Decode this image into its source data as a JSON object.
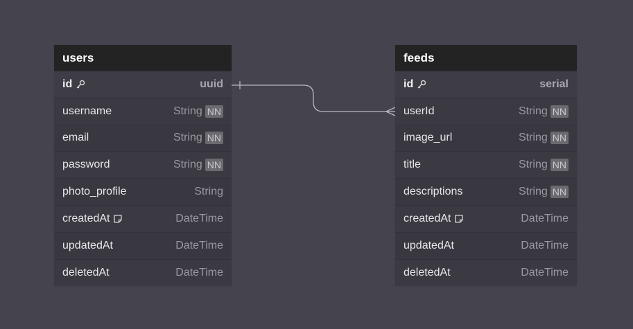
{
  "tables": [
    {
      "name": "users",
      "fields": [
        {
          "name": "id",
          "type": "uuid",
          "pk": true,
          "nn": false,
          "icon": "key-icon"
        },
        {
          "name": "username",
          "type": "String",
          "pk": false,
          "nn": true,
          "icon": ""
        },
        {
          "name": "email",
          "type": "String",
          "pk": false,
          "nn": true,
          "icon": ""
        },
        {
          "name": "password",
          "type": "String",
          "pk": false,
          "nn": true,
          "icon": ""
        },
        {
          "name": "photo_profile",
          "type": "String",
          "pk": false,
          "nn": false,
          "icon": ""
        },
        {
          "name": "createdAt",
          "type": "DateTime",
          "pk": false,
          "nn": false,
          "icon": "note-icon"
        },
        {
          "name": "updatedAt",
          "type": "DateTime",
          "pk": false,
          "nn": false,
          "icon": ""
        },
        {
          "name": "deletedAt",
          "type": "DateTime",
          "pk": false,
          "nn": false,
          "icon": ""
        }
      ]
    },
    {
      "name": "feeds",
      "fields": [
        {
          "name": "id",
          "type": "serial",
          "pk": true,
          "nn": false,
          "icon": "key-icon"
        },
        {
          "name": "userId",
          "type": "String",
          "pk": false,
          "nn": true,
          "icon": ""
        },
        {
          "name": "image_url",
          "type": "String",
          "pk": false,
          "nn": true,
          "icon": ""
        },
        {
          "name": "title",
          "type": "String",
          "pk": false,
          "nn": true,
          "icon": ""
        },
        {
          "name": "descriptions",
          "type": "String",
          "pk": false,
          "nn": true,
          "icon": ""
        },
        {
          "name": "createdAt",
          "type": "DateTime",
          "pk": false,
          "nn": false,
          "icon": "note-icon"
        },
        {
          "name": "updatedAt",
          "type": "DateTime",
          "pk": false,
          "nn": false,
          "icon": ""
        },
        {
          "name": "deletedAt",
          "type": "DateTime",
          "pk": false,
          "nn": false,
          "icon": ""
        }
      ]
    }
  ],
  "nn_label": "NN",
  "relation": {
    "from": "users.id",
    "to": "feeds.userId",
    "from_cardinality": "one",
    "to_cardinality": "many"
  },
  "colors": {
    "canvas": "#45444e",
    "header": "#232323",
    "row": "#393841",
    "line": "#b9b8c0"
  }
}
